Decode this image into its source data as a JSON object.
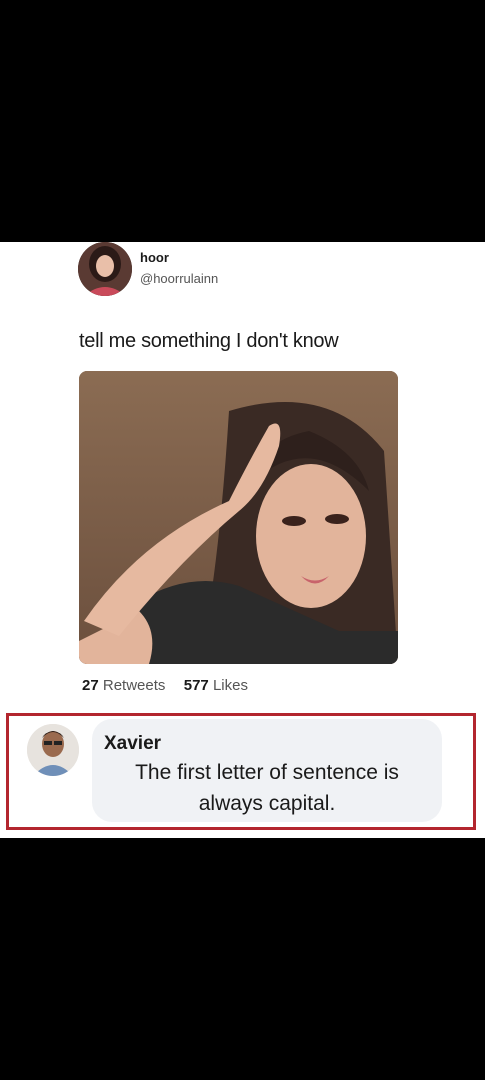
{
  "tweet": {
    "name": "hoor",
    "handle": "@hoorrulainn",
    "text": "tell me something I don't know",
    "retweets_count": "27",
    "retweets_label": "Retweets",
    "likes_count": "577",
    "likes_label": "Likes"
  },
  "reply": {
    "name": "Xavier",
    "text": "The first letter of sentence is always capital."
  },
  "colors": {
    "highlight_border": "#b3262e",
    "bubble_bg": "#f0f2f5"
  }
}
